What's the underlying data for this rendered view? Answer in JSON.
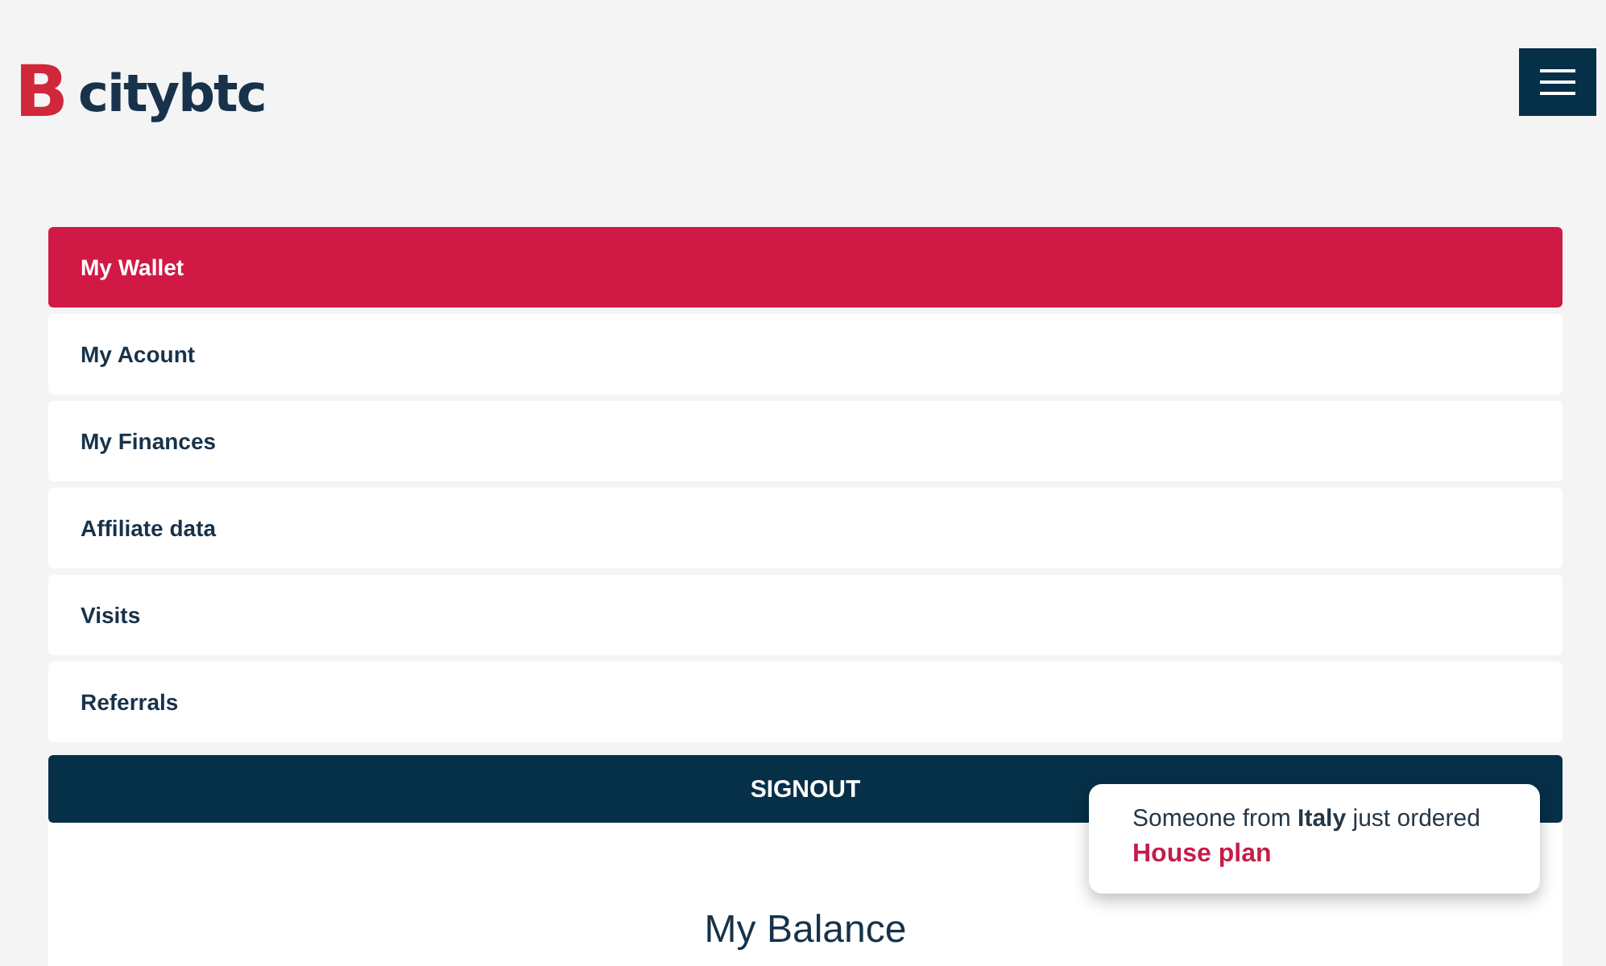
{
  "logo": {
    "text": "citybtc",
    "symbol": "B"
  },
  "menu_items": [
    {
      "label": "My Wallet",
      "selected": true
    },
    {
      "label": "My Acount",
      "selected": false
    },
    {
      "label": "My Finances",
      "selected": false
    },
    {
      "label": "Affiliate data",
      "selected": false
    },
    {
      "label": "Visits",
      "selected": false
    },
    {
      "label": "Referrals",
      "selected": false
    }
  ],
  "signout": "SIGNOUT",
  "balance_title": "My Balance",
  "toast": {
    "message": "Someone from **Italy** just ordered",
    "product": "House plan"
  }
}
